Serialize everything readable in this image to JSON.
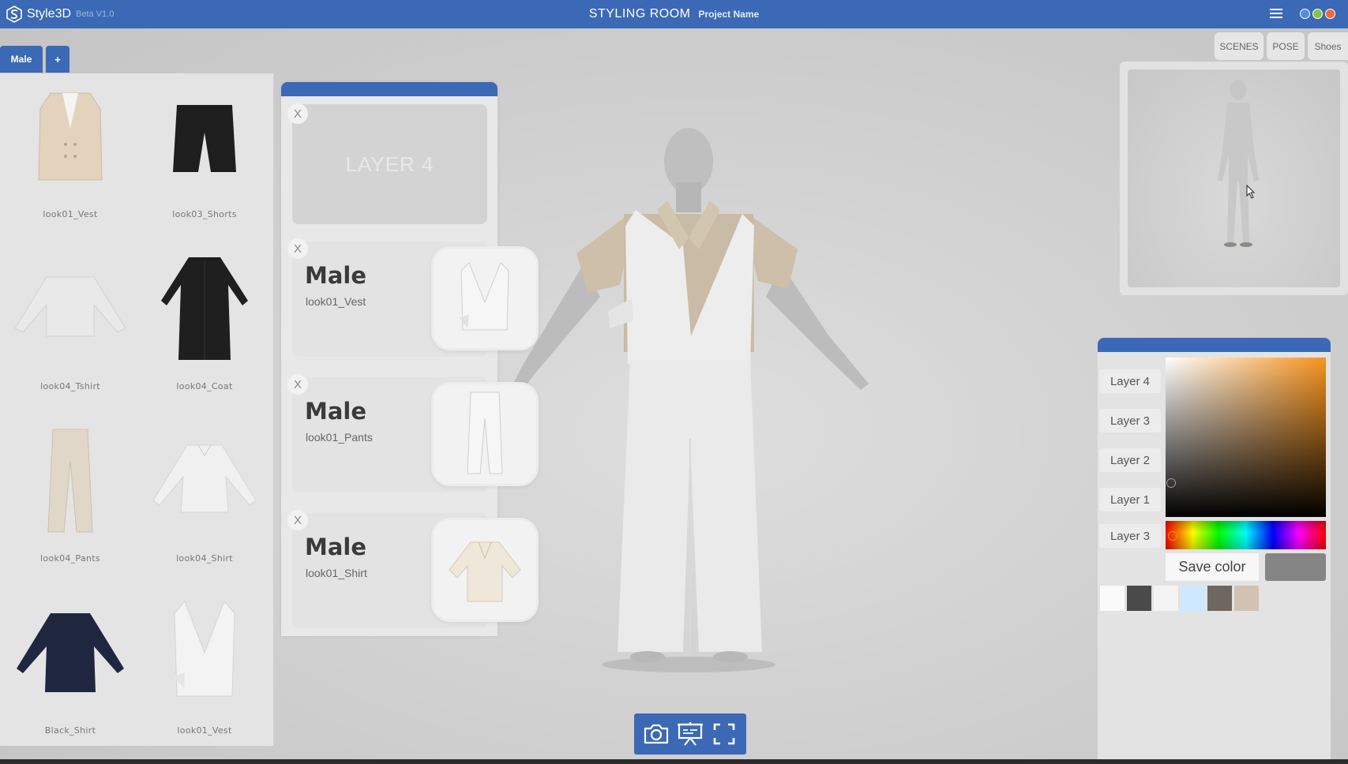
{
  "header": {
    "brand": "Style3D",
    "beta": "Beta V1.0",
    "title": "STYLING ROOM",
    "project": "Project Name"
  },
  "tabs": {
    "category": "Male",
    "add": "+"
  },
  "library": {
    "items": [
      {
        "label": "look01_Vest",
        "icon": "vest-icon"
      },
      {
        "label": "look03_Shorts",
        "icon": "shorts-icon"
      },
      {
        "label": "look04_Tshirt",
        "icon": "tshirt-icon"
      },
      {
        "label": "look04_Coat",
        "icon": "coat-icon"
      },
      {
        "label": "look04_Pants",
        "icon": "pants-icon"
      },
      {
        "label": "look04_Shirt",
        "icon": "shirt-icon"
      },
      {
        "label": "Black_Shirt",
        "icon": "shirt-icon"
      },
      {
        "label": "look01_Vest",
        "icon": "vest-icon"
      }
    ]
  },
  "layers": {
    "empty_label": "LAYER 4",
    "close": "X",
    "cards": [
      {
        "title": "Male",
        "sub": "look01_Vest"
      },
      {
        "title": "Male",
        "sub": "look01_Pants"
      },
      {
        "title": "Male",
        "sub": "look01_Shirt"
      }
    ]
  },
  "view_buttons": {
    "scenes": "SCENES",
    "pose": "POSE",
    "shoes": "Shoes"
  },
  "color_panel": {
    "layer_buttons": [
      "Layer 4",
      "Layer 3",
      "Layer 2",
      "Layer 1",
      "Layer 3"
    ],
    "save_label": "Save color",
    "current_color": "#858585",
    "swatches": [
      "#fafafa",
      "#4a4a4a",
      "#f3f3f3",
      "#cde8ff",
      "#6e6660",
      "#d2c2b4"
    ]
  },
  "colors": {
    "accent": "#3b69b5"
  }
}
